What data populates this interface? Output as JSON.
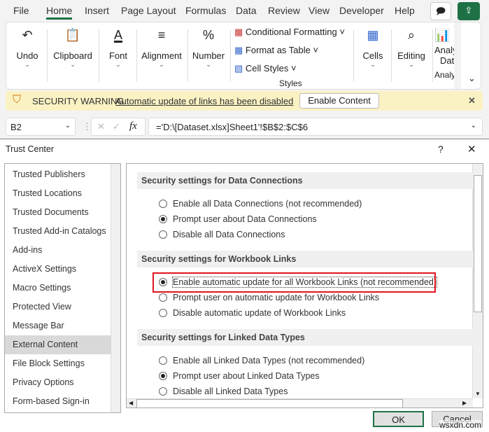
{
  "tabs": [
    "File",
    "Home",
    "Insert",
    "Page Layout",
    "Formulas",
    "Data",
    "Review",
    "View",
    "Developer",
    "Help"
  ],
  "ribbon": {
    "undo": "Undo",
    "clipboard": "Clipboard",
    "font": "Font",
    "alignment": "Alignment",
    "number": "Number",
    "conditional_formatting": "Conditional Formatting",
    "format_as_table": "Format as Table",
    "cell_styles": "Cell Styles",
    "styles_group": "Styles",
    "cells": "Cells",
    "editing": "Editing",
    "analyze_data_1": "Analy",
    "analyze_data_2": "Dat",
    "analysis_group": "Analy"
  },
  "warning": {
    "title": "SECURITY WARNING",
    "message": "Automatic update of links has been disabled",
    "button": "Enable Content"
  },
  "formula_bar": {
    "name_box": "B2",
    "fx": "fx",
    "formula": "='D:\\[Dataset.xlsx]Sheet1'!$B$2:$C$6"
  },
  "dialog": {
    "title": "Trust Center",
    "help": "?",
    "close": "✕",
    "ok": "OK",
    "cancel": "Cancel"
  },
  "sidebar": [
    "Trusted Publishers",
    "Trusted Locations",
    "Trusted Documents",
    "Trusted Add-in Catalogs",
    "Add-ins",
    "ActiveX Settings",
    "Macro Settings",
    "Protected View",
    "Message Bar",
    "External Content",
    "File Block Settings",
    "Privacy Options",
    "Form-based Sign-in"
  ],
  "sections": [
    {
      "title": "Security settings for Data Connections",
      "options": [
        "Enable all Data Connections (not recommended)",
        "Prompt user about Data Connections",
        "Disable all Data Connections"
      ],
      "selected": 1
    },
    {
      "title": "Security settings for Workbook Links",
      "options": [
        "Enable automatic update for all Workbook Links (not recommended)",
        "Prompt user on automatic update for Workbook Links",
        "Disable automatic update of Workbook Links"
      ],
      "selected": 0
    },
    {
      "title": "Security settings for Linked Data Types",
      "options": [
        "Enable all Linked Data Types (not recommended)",
        "Prompt user about Linked Data Types",
        "Disable all Linked Data Types"
      ],
      "selected": 1
    }
  ],
  "watermark": "wsxdn.com",
  "colors": {
    "accent": "#1e7145",
    "highlight": "#e0141e",
    "warning_bg": "#fbf2c4"
  }
}
